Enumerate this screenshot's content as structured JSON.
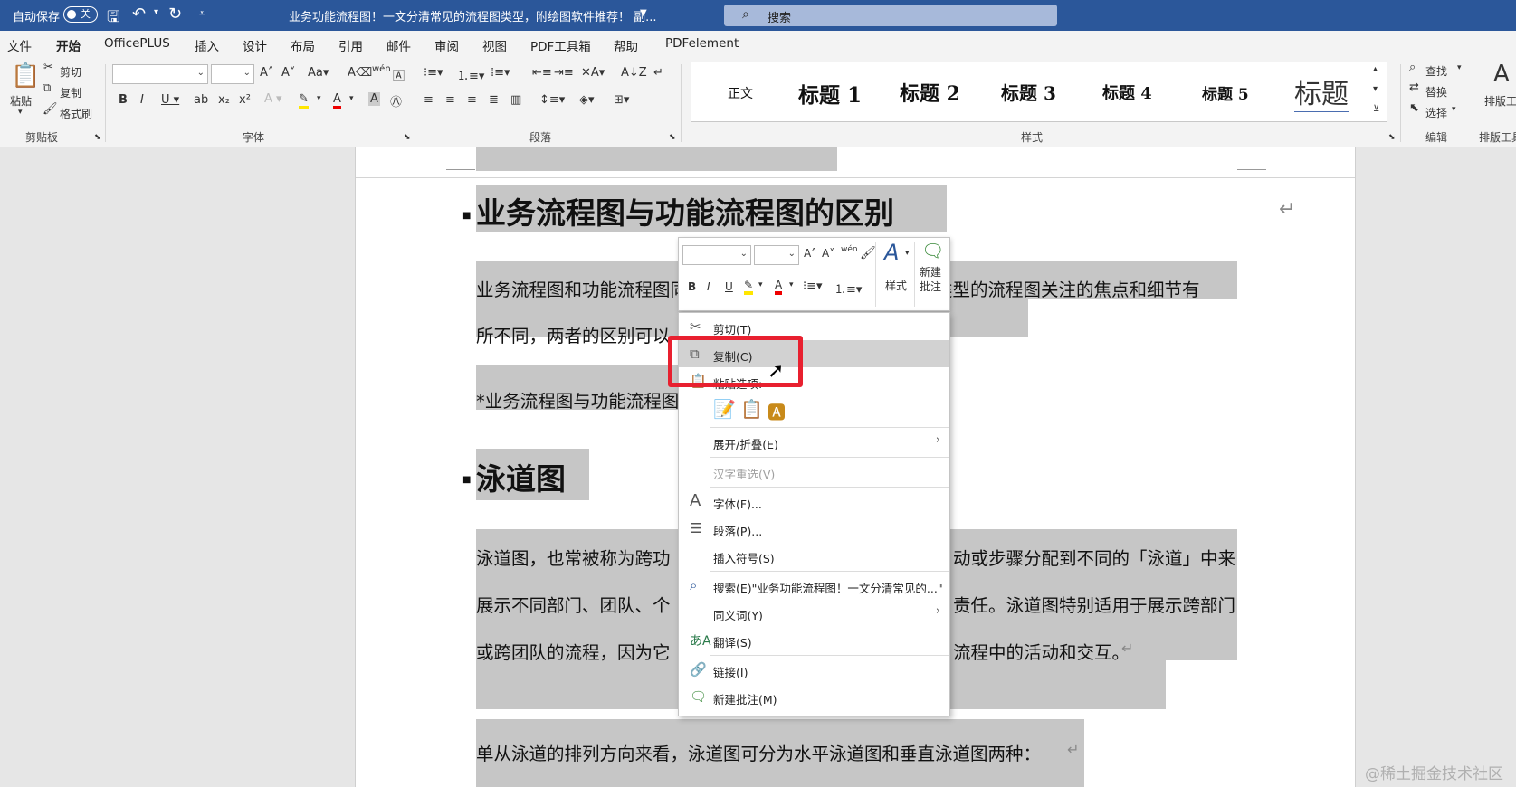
{
  "titlebar": {
    "autosave_label": "自动保存",
    "autosave_state": "关",
    "doc_title": "业务功能流程图！一文分清常见的流程图类型，附绘图软件推荐！ 副...",
    "search_placeholder": "搜索"
  },
  "menu": [
    "文件",
    "开始",
    "OfficePLUS",
    "插入",
    "设计",
    "布局",
    "引用",
    "邮件",
    "审阅",
    "视图",
    "PDF工具箱",
    "帮助",
    "PDFelement"
  ],
  "menu_active": "开始",
  "ribbon": {
    "clipboard": {
      "paste": "粘贴",
      "cut": "剪切",
      "copy": "复制",
      "format_painter": "格式刷",
      "label": "剪贴板"
    },
    "font": {
      "label": "字体"
    },
    "paragraph": {
      "label": "段落"
    },
    "styles": {
      "items": [
        "正文",
        "标题 1",
        "标题 2",
        "标题 3",
        "标题 4",
        "标题 5",
        "标题"
      ],
      "label": "样式"
    },
    "editing": {
      "find": "查找",
      "replace": "替换",
      "select": "选择",
      "label": "编辑"
    },
    "layout": {
      "label": "排版工具"
    }
  },
  "document": {
    "heading1": "业务流程图与功能流程图的区别",
    "para1_line1": "业务流程图和功能流程图同属于流程图这个大类，但这两种类型的流程图关注的焦点和细节有",
    "para1_line2": "所不同，两者的区别可以",
    "para2": "*业务流程图与功能流程图",
    "heading2": "泳道图",
    "para3_line1_a": "泳道图，也常被称为跨功",
    "para3_line1_b": "动或步骤分配到不同的「泳道」中来",
    "para3_line2_a": "展示不同部门、团队、个",
    "para3_line2_b": "责任。泳道图特别适用于展示跨部门",
    "para3_line3_a": "或跨团队的流程，因为它",
    "para3_line3_b": "流程中的活动和交互。",
    "para4": "单从泳道的排列方向来看，泳道图可分为水平泳道图和垂直泳道图两种：",
    "para_mark": "↵"
  },
  "mini_toolbar": {
    "styles_label": "样式",
    "new_comment_label": "新建\n批注"
  },
  "context_menu": {
    "cut": "剪切(T)",
    "copy": "复制(C)",
    "paste_options": "粘贴选项:",
    "expand_collapse": "展开/折叠(E)",
    "hanzi_reselect": "汉字重选(V)",
    "font": "字体(F)...",
    "paragraph": "段落(P)...",
    "insert_symbol": "插入符号(S)",
    "search": "搜索(E)\"业务功能流程图！一文分清常见的...\"",
    "synonyms": "同义词(Y)",
    "translate": "翻译(S)",
    "link": "链接(I)",
    "new_comment": "新建批注(M)"
  },
  "watermark": "@稀土掘金技术社区",
  "colors": {
    "titlebar": "#2b579a",
    "highlight_box": "#e8202f",
    "selection": "#c6c6c6"
  }
}
